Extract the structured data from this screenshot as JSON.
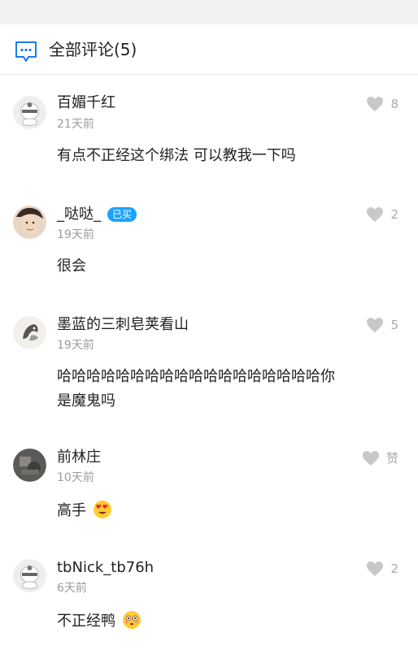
{
  "header": {
    "title": "全部评论(5)",
    "icon": "comment-bubble-icon",
    "accent": "#1a7ce8"
  },
  "comments": [
    {
      "user": "百媚千红",
      "time": "21天前",
      "text": "有点不正经这个绑法 可以教我一下吗",
      "likes": "8",
      "avatar": "default-cartoon-avatar"
    },
    {
      "user": "_哒哒_",
      "badge": "已买",
      "time": "19天前",
      "text": "很会",
      "likes": "2",
      "avatar": "user-photo-avatar"
    },
    {
      "user": "墨蓝的三刺皂荚看山",
      "time": "19天前",
      "text_line1": "哈哈哈哈哈哈哈哈哈哈哈哈哈哈哈哈哈哈你",
      "text_line2": "是魔鬼吗",
      "likes": "5",
      "avatar": "ink-painting-avatar"
    },
    {
      "user": "前林庄",
      "time": "10天前",
      "text": "高手",
      "emoji": "heart-eyes-emoji",
      "likes": "赞",
      "avatar": "dark-photo-avatar"
    },
    {
      "user": "tbNick_tb76h",
      "time": "6天前",
      "text": "不正经鸭",
      "emoji": "flushed-face-emoji",
      "likes": "2",
      "avatar": "default-cartoon-avatar"
    }
  ],
  "colors": {
    "badge": "#1aa3ff",
    "heart": "#c8c8c8",
    "time": "#9b9b9b"
  }
}
